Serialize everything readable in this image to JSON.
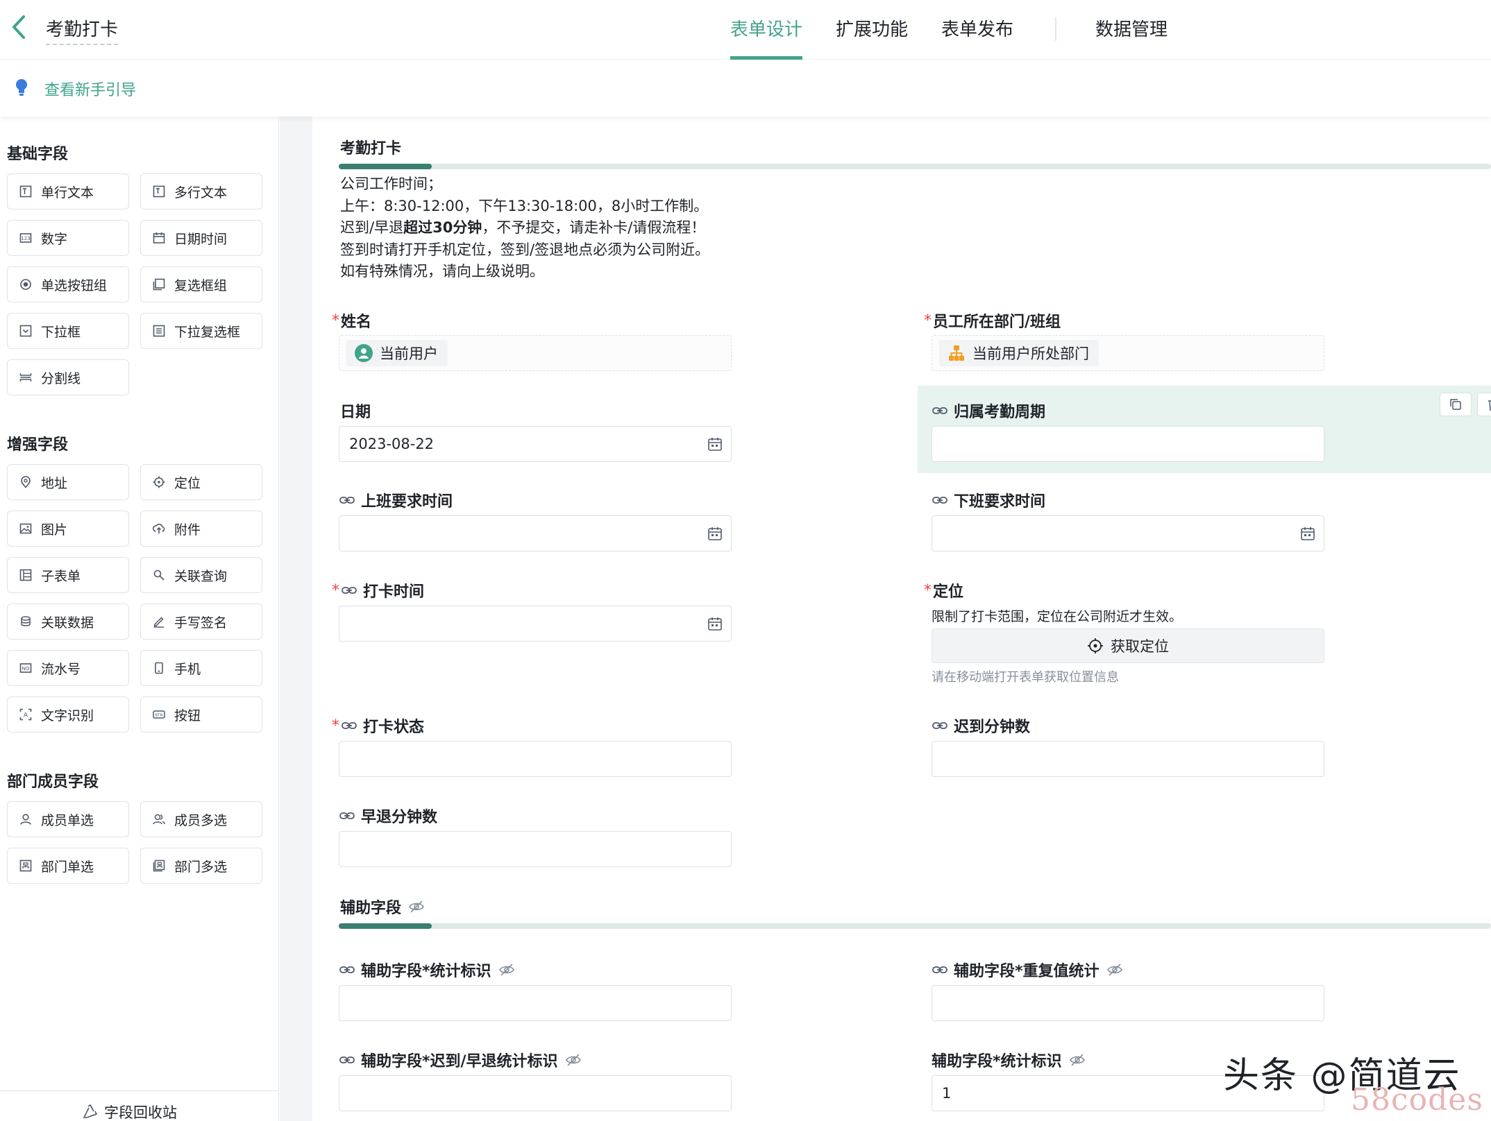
{
  "header": {
    "title": "考勤打卡",
    "tabs": [
      {
        "label": "表单设计",
        "active": true
      },
      {
        "label": "扩展功能",
        "active": false
      },
      {
        "label": "表单发布",
        "active": false
      },
      {
        "label": "数据管理",
        "active": false
      }
    ]
  },
  "guide": {
    "label": "查看新手引导"
  },
  "sidebar": {
    "basic_title": "基础字段",
    "basic": [
      {
        "label": "单行文本",
        "icon": "single-line-text-icon"
      },
      {
        "label": "多行文本",
        "icon": "multi-line-text-icon"
      },
      {
        "label": "数字",
        "icon": "number-icon"
      },
      {
        "label": "日期时间",
        "icon": "calendar-icon"
      },
      {
        "label": "单选按钮组",
        "icon": "radio-icon"
      },
      {
        "label": "复选框组",
        "icon": "checkbox-icon"
      },
      {
        "label": "下拉框",
        "icon": "dropdown-icon"
      },
      {
        "label": "下拉复选框",
        "icon": "dropdown-multi-icon"
      },
      {
        "label": "分割线",
        "icon": "divider-icon"
      }
    ],
    "enhanced_title": "增强字段",
    "enhanced": [
      {
        "label": "地址",
        "icon": "map-pin-icon"
      },
      {
        "label": "定位",
        "icon": "locate-icon"
      },
      {
        "label": "图片",
        "icon": "image-icon"
      },
      {
        "label": "附件",
        "icon": "upload-icon"
      },
      {
        "label": "子表单",
        "icon": "subform-icon"
      },
      {
        "label": "关联查询",
        "icon": "link-query-icon"
      },
      {
        "label": "关联数据",
        "icon": "link-data-icon"
      },
      {
        "label": "手写签名",
        "icon": "pen-icon"
      },
      {
        "label": "流水号",
        "icon": "serial-number-icon"
      },
      {
        "label": "手机",
        "icon": "phone-icon"
      },
      {
        "label": "文字识别",
        "icon": "ocr-icon"
      },
      {
        "label": "按钮",
        "icon": "button-icon"
      }
    ],
    "member_title": "部门成员字段",
    "member": [
      {
        "label": "成员单选",
        "icon": "user-icon"
      },
      {
        "label": "成员多选",
        "icon": "users-icon"
      },
      {
        "label": "部门单选",
        "icon": "dept-icon"
      },
      {
        "label": "部门多选",
        "icon": "depts-icon"
      }
    ],
    "recycle": "字段回收站"
  },
  "form": {
    "group1_title": "考勤打卡",
    "desc": {
      "line1": "公司工作时间；",
      "line2": "上午：8:30-12:00，下午13:30-18:00，8小时工作制。",
      "line3_pre": "迟到/早退",
      "line3_bold": "超过30分钟",
      "line3_post": "，不予提交，请走补卡/请假流程！",
      "line4": "签到时请打开手机定位，签到/签退地点必须为公司附近。",
      "line5": "如有特殊情况，请向上级说明。"
    },
    "name": {
      "label": "姓名",
      "chip": "当前用户"
    },
    "dept": {
      "label": "员工所在部门/班组",
      "chip": "当前用户所处部门"
    },
    "date": {
      "label": "日期",
      "value": "2023-08-22"
    },
    "period": {
      "label": "归属考勤周期"
    },
    "start_time": {
      "label": "上班要求时间"
    },
    "end_time": {
      "label": "下班要求时间"
    },
    "punch_time": {
      "label": "打卡时间"
    },
    "location": {
      "label": "定位",
      "hint": "限制了打卡范围，定位在公司附近才生效。",
      "button": "获取定位",
      "note": "请在移动端打开表单获取位置信息"
    },
    "punch_status": {
      "label": "打卡状态"
    },
    "late_minutes": {
      "label": "迟到分钟数"
    },
    "early_minutes": {
      "label": "早退分钟数"
    },
    "group2_title": "辅助字段",
    "aux_stat": {
      "label": "辅助字段*统计标识"
    },
    "aux_dup": {
      "label": "辅助字段*重复值统计"
    },
    "aux_late_early": {
      "label": "辅助字段*迟到/早退统计标识"
    },
    "aux_stat2": {
      "label": "辅助字段*统计标识",
      "value": "1"
    },
    "required_mark": "*"
  },
  "watermark": {
    "line1": "头条 @简道云",
    "line2": "58codes"
  },
  "colors": {
    "accent": "#3fa48b",
    "required": "#f53f3f",
    "selected_bg": "#e6f3ef"
  }
}
